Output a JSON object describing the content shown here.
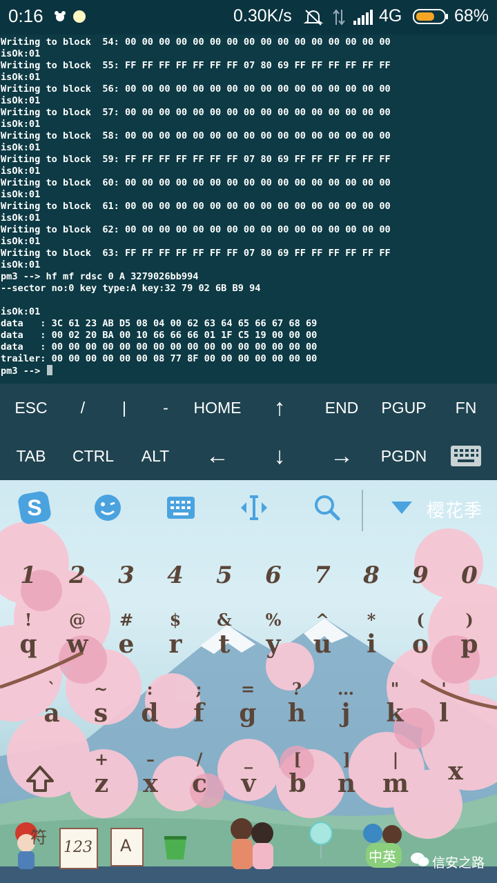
{
  "status_bar": {
    "time": "0:16",
    "speed": "0.30K/s",
    "network": "4G",
    "battery": "68%",
    "battery_level": 0.68,
    "icons": [
      "notification-icon",
      "sun-dot-icon",
      "mute-icon",
      "data-transfer-icon",
      "signal-icon",
      "battery-icon"
    ]
  },
  "terminal": {
    "lines": [
      "Writing to block  54: 00 00 00 00 00 00 00 00 00 00 00 00 00 00 00 00",
      "isOk:01",
      "Writing to block  55: FF FF FF FF FF FF FF 07 80 69 FF FF FF FF FF FF",
      "isOk:01",
      "Writing to block  56: 00 00 00 00 00 00 00 00 00 00 00 00 00 00 00 00",
      "isOk:01",
      "Writing to block  57: 00 00 00 00 00 00 00 00 00 00 00 00 00 00 00 00",
      "isOk:01",
      "Writing to block  58: 00 00 00 00 00 00 00 00 00 00 00 00 00 00 00 00",
      "isOk:01",
      "Writing to block  59: FF FF FF FF FF FF FF 07 80 69 FF FF FF FF FF FF",
      "isOk:01",
      "Writing to block  60: 00 00 00 00 00 00 00 00 00 00 00 00 00 00 00 00",
      "isOk:01",
      "Writing to block  61: 00 00 00 00 00 00 00 00 00 00 00 00 00 00 00 00",
      "isOk:01",
      "Writing to block  62: 00 00 00 00 00 00 00 00 00 00 00 00 00 00 00 00",
      "isOk:01",
      "Writing to block  63: FF FF FF FF FF FF FF 07 80 69 FF FF FF FF FF FF",
      "isOk:01",
      "pm3 --> hf mf rdsc 0 A 3279026bb994",
      "--sector no:0 key type:A key:32 79 02 6B B9 94",
      "",
      "isOk:01",
      "data   : 3C 61 23 AB D5 08 04 00 62 63 64 65 66 67 68 69",
      "data   : 00 02 20 BA 00 10 66 66 66 01 1F C5 19 00 00 00",
      "data   : 00 00 00 00 00 00 00 00 00 00 00 00 00 00 00 00",
      "trailer: 00 00 00 00 00 00 08 77 8F 00 00 00 00 00 00 00"
    ],
    "prompt": "pm3 --> "
  },
  "extra_keys": {
    "row1": [
      "ESC",
      "/",
      "|",
      "-",
      "HOME",
      "↑",
      "END",
      "PGUP",
      "FN"
    ],
    "row2": [
      "TAB",
      "CTRL",
      "ALT",
      "←",
      "↓",
      "→",
      "PGDN"
    ]
  },
  "ime": {
    "theme_name": "樱花季",
    "toolbar_icons": [
      "sogou-logo-icon",
      "emoji-icon",
      "keyboard-icon",
      "cursor-move-icon",
      "search-icon",
      "collapse-icon"
    ],
    "numbers": [
      "1",
      "2",
      "3",
      "4",
      "5",
      "6",
      "7",
      "8",
      "9",
      "0"
    ],
    "row1": [
      {
        "alt": "!",
        "main": "q"
      },
      {
        "alt": "@",
        "main": "w"
      },
      {
        "alt": "#",
        "main": "e"
      },
      {
        "alt": "$",
        "main": "r"
      },
      {
        "alt": "&",
        "main": "t"
      },
      {
        "alt": "%",
        "main": "y"
      },
      {
        "alt": "^",
        "main": "u"
      },
      {
        "alt": "*",
        "main": "i"
      },
      {
        "alt": "(",
        "main": "o"
      },
      {
        "alt": ")",
        "main": "p"
      }
    ],
    "row2": [
      {
        "alt": "`",
        "main": "a"
      },
      {
        "alt": "~",
        "main": "s"
      },
      {
        "alt": ":",
        "main": "d"
      },
      {
        "alt": ";",
        "main": "f"
      },
      {
        "alt": "=",
        "main": "g"
      },
      {
        "alt": "?",
        "main": "h"
      },
      {
        "alt": "…",
        "main": "j"
      },
      {
        "alt": "\"",
        "main": "k"
      },
      {
        "alt": "'",
        "main": "l"
      }
    ],
    "row3": [
      {
        "alt": "+",
        "main": "z"
      },
      {
        "alt": "–",
        "main": "x"
      },
      {
        "alt": "/",
        "main": "c"
      },
      {
        "alt": "_",
        "main": "v"
      },
      {
        "alt": "[",
        "main": "b"
      },
      {
        "alt": "]",
        "main": "n"
      },
      {
        "alt": "|",
        "main": "m"
      }
    ],
    "delete_label": "x",
    "bottom_tray": {
      "symbol_key": "符",
      "number_key": "123",
      "letter_key": "A",
      "lang_key": "中英",
      "watermark": "信安之路"
    }
  }
}
